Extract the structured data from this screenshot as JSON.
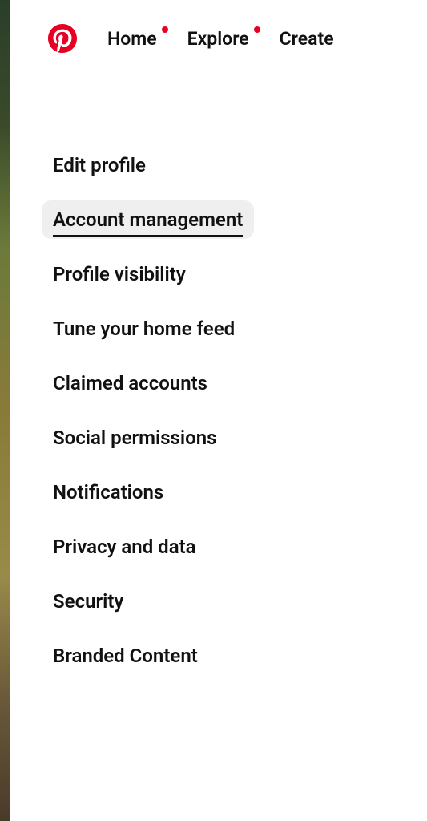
{
  "brand": {
    "name": "Pinterest",
    "accent_color": "#e60023"
  },
  "topnav": {
    "items": [
      {
        "label": "Home",
        "has_dot": true
      },
      {
        "label": "Explore",
        "has_dot": true
      },
      {
        "label": "Create",
        "has_dot": false
      }
    ]
  },
  "settings_nav": {
    "items": [
      {
        "label": "Edit profile",
        "active": false
      },
      {
        "label": "Account management",
        "active": true
      },
      {
        "label": "Profile visibility",
        "active": false
      },
      {
        "label": "Tune your home feed",
        "active": false
      },
      {
        "label": "Claimed accounts",
        "active": false
      },
      {
        "label": "Social permissions",
        "active": false
      },
      {
        "label": "Notifications",
        "active": false
      },
      {
        "label": "Privacy and data",
        "active": false
      },
      {
        "label": "Security",
        "active": false
      },
      {
        "label": "Branded Content",
        "active": false
      }
    ]
  }
}
